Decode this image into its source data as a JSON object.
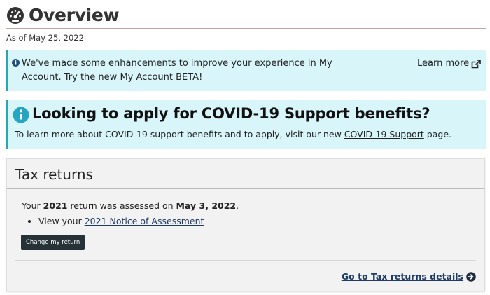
{
  "page": {
    "title": "Overview",
    "as_of": "As of May 25, 2022"
  },
  "notice_beta": {
    "text_before": "We've made some enhancements to improve your experience in My Account. Try the new ",
    "link_label": "My Account BETA",
    "text_after": "!",
    "learn_more": "Learn more"
  },
  "notice_covid": {
    "heading": "Looking to apply for COVID-19 Support benefits?",
    "text_before": "To learn more about COVID-19 support benefits and to apply, visit our new ",
    "link_label": "COVID-19 Support",
    "text_after": " page."
  },
  "tax_returns": {
    "heading": "Tax returns",
    "status_prefix": "Your ",
    "year": "2021",
    "status_middle": " return was assessed on ",
    "assessed_date": "May 3, 2022",
    "status_suffix": ".",
    "bullet_prefix": "View your ",
    "notice_link": "2021 Notice of Assessment",
    "change_button": "Change my return",
    "details_link": "Go to Tax returns details"
  },
  "icons": {
    "title": "dashboard-gauge-icon",
    "info": "info-circle-icon",
    "external": "external-link-icon",
    "arrow": "arrow-circle-right-icon"
  },
  "colors": {
    "notice_bg": "#d8f5fa",
    "notice_border": "#26a5c1",
    "button_bg": "#263238",
    "link_dark": "#1f3b63"
  }
}
